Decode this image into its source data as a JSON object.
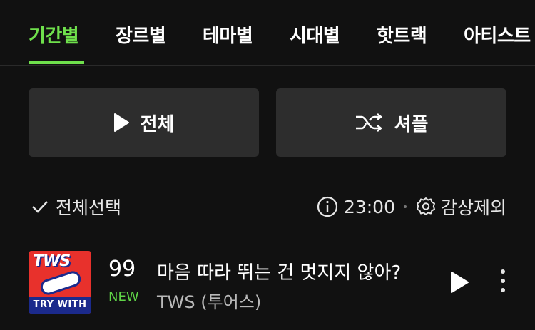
{
  "tabs": [
    {
      "label": "기간별",
      "active": true
    },
    {
      "label": "장르별",
      "active": false
    },
    {
      "label": "테마별",
      "active": false
    },
    {
      "label": "시대별",
      "active": false
    },
    {
      "label": "핫트랙",
      "active": false
    },
    {
      "label": "아티스트",
      "active": false
    }
  ],
  "actions": {
    "play_all_label": "전체",
    "shuffle_label": "셔플"
  },
  "list_controls": {
    "select_all_label": "전체선택",
    "time": "23:00",
    "exclude_listening_label": "감상제외"
  },
  "songs": [
    {
      "rank": "99",
      "rank_badge": "NEW",
      "title": "마음 따라 뛰는 건 멋지지 않아?",
      "artist": "TWS (투어스)",
      "album_art_text": "TWS",
      "album_art_band": "TRY WITH US"
    }
  ],
  "colors": {
    "accent": "#6fe04c",
    "background": "#111111",
    "button_bg": "#2d2d2d"
  },
  "icons": {
    "play": "play-icon",
    "shuffle": "shuffle-icon",
    "check": "check-icon",
    "info": "info-icon",
    "gear": "gear-icon",
    "more": "more-vertical-icon"
  }
}
